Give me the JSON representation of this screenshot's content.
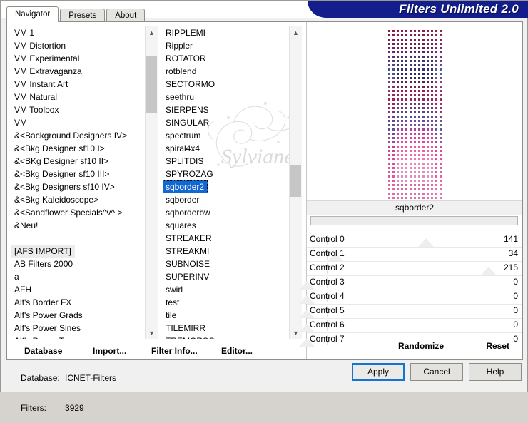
{
  "window": {
    "title": "Filters Unlimited 2.0"
  },
  "tabs": [
    {
      "label": "Navigator",
      "active": true
    },
    {
      "label": "Presets",
      "active": false
    },
    {
      "label": "About",
      "active": false
    }
  ],
  "categories": {
    "items": [
      "VM 1",
      "VM Distortion",
      "VM Experimental",
      "VM Extravaganza",
      "VM Instant Art",
      "VM Natural",
      "VM Toolbox",
      "VM",
      "&<Background Designers IV>",
      "&<Bkg Designer sf10 I>",
      "&<BKg Designer sf10 II>",
      "&<Bkg Designer sf10 III>",
      "&<Bkg Designers sf10 IV>",
      "&<Bkg Kaleidoscope>",
      "&<Sandflower Specials^v^ >",
      "&Neu!",
      "",
      "[AFS IMPORT]",
      "AB Filters 2000",
      "a",
      "AFH",
      "Alf's Border FX",
      "Alf's Power Grads",
      "Alf's Power Sines",
      "Alf's Power Toys"
    ],
    "focused": "[AFS IMPORT]"
  },
  "filters": {
    "items": [
      "RIPPLEMI",
      "Rippler",
      "ROTATOR",
      "rotblend",
      "SECTORMO",
      "seethru",
      "SIERPENS",
      "SINGULAR",
      "spectrum",
      "spiral4x4",
      "SPLITDIS",
      "SPYROZAG",
      "sqborder2",
      "sqborder",
      "sqborderbw",
      "squares",
      "STREAKER",
      "STREAKMI",
      "SUBNOISE",
      "SUPERINV",
      "swirl",
      "test",
      "tile",
      "TILEMIRR",
      "TREMORSC"
    ],
    "selected": "sqborder2"
  },
  "watermark": {
    "text": "Sylviane"
  },
  "preview": {
    "filter_name": "sqborder2",
    "progress_percent": 0
  },
  "controls": [
    {
      "label": "Control 0",
      "value": 141
    },
    {
      "label": "Control 1",
      "value": 34
    },
    {
      "label": "Control 2",
      "value": 215
    },
    {
      "label": "Control 3",
      "value": 0
    },
    {
      "label": "Control 4",
      "value": 0
    },
    {
      "label": "Control 5",
      "value": 0
    },
    {
      "label": "Control 6",
      "value": 0
    },
    {
      "label": "Control 7",
      "value": 0
    }
  ],
  "links": {
    "database": "Database",
    "import": "Import...",
    "filter_info": "Filter Info...",
    "editor": "Editor...",
    "randomize": "Randomize",
    "reset": "Reset"
  },
  "status": {
    "database_label": "Database:",
    "database_value": "ICNET-Filters",
    "filters_label": "Filters:",
    "filters_value": "3929"
  },
  "buttons": {
    "apply": "Apply",
    "cancel": "Cancel",
    "help": "Help"
  },
  "colors": {
    "banner": "#131e8c",
    "selection": "#1268d0",
    "default_button_focus": "#1274d4",
    "window_bg": "#d6d3ce",
    "panel_bg": "#f0f0f0"
  },
  "scrollbars": {
    "left": {
      "thumb_top_pct": 6,
      "thumb_height_pct": 20
    },
    "middle": {
      "thumb_top_pct": 44,
      "thumb_height_pct": 11
    }
  }
}
